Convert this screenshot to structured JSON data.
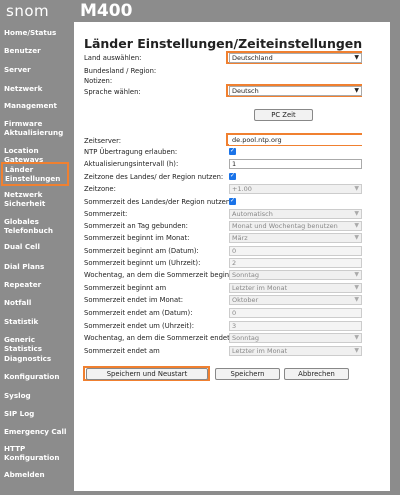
{
  "header": {
    "brand": "snom",
    "model": "M400"
  },
  "sidebar": {
    "items": [
      {
        "label": "Home/Status"
      },
      {
        "label": "Benutzer"
      },
      {
        "label": "Server"
      },
      {
        "label": "Netzwerk"
      },
      {
        "label": "Management"
      },
      {
        "label": "Firmware Aktualisierung"
      },
      {
        "label": "Location Gateways"
      },
      {
        "label": "Länder Einstellungen"
      },
      {
        "label": "Netzwerk Sicherheit"
      },
      {
        "label": "Globales Telefonbuch"
      },
      {
        "label": "Dual Cell"
      },
      {
        "label": "Dial Plans"
      },
      {
        "label": "Repeater"
      },
      {
        "label": "Notfall"
      },
      {
        "label": "Statistik"
      },
      {
        "label": "Generic Statistics"
      },
      {
        "label": "Diagnostics"
      },
      {
        "label": "Konfiguration"
      },
      {
        "label": "Syslog"
      },
      {
        "label": "SIP Log"
      },
      {
        "label": "Emergency Call"
      },
      {
        "label": "HTTP Konfiguration"
      },
      {
        "label": "Abmelden"
      }
    ]
  },
  "main": {
    "title": "Länder Einstellungen/Zeiteinstellungen",
    "country_label": "Land auswählen:",
    "country_value": "Deutschland",
    "region_label": "Bundesland / Region:",
    "notes_label": "Notizen:",
    "language_label": "Sprache wählen:",
    "language_value": "Deutsch",
    "pc_time_button": "PC Zeit",
    "timeserver_label": "Zeitserver:",
    "timeserver_value": "de.pool.ntp.org",
    "ntp_label": "NTP Übertragung erlauben:",
    "ntp_checked": true,
    "interval_label": "Aktualisierungsintervall (h):",
    "interval_value": "1",
    "use_region_tz_label": "Zeitzone des Landes/ der Region nutzen:",
    "use_region_tz_checked": true,
    "timezone_label": "Zeitzone:",
    "timezone_value": "+1.00",
    "use_region_dst_label": "Sommerzeit des Landes/der Region nutzen:",
    "use_region_dst_checked": true,
    "dst_label": "Sommerzeit:",
    "dst_value": "Automatisch",
    "dst_day_label": "Sommerzeit an Tag gebunden:",
    "dst_day_value": "Monat und Wochentag benutzen",
    "dst_start_month_label": "Sommerzeit beginnt im Monat:",
    "dst_start_month_value": "März",
    "dst_start_date_label": "Sommerzeit beginnt am (Datum):",
    "dst_start_date_value": "0",
    "dst_start_time_label": "Sommerzeit beginnt um (Uhrzeit):",
    "dst_start_time_value": "2",
    "dst_start_weekday_label": "Wochentag, an dem die Sommerzeit beginnt:",
    "dst_start_weekday_value": "Sonntag",
    "dst_start_on_label": "Sommerzeit beginnt am",
    "dst_start_on_value": "Letzter im Monat",
    "dst_end_month_label": "Sommerzeit endet im Monat:",
    "dst_end_month_value": "Oktober",
    "dst_end_date_label": "Sommerzeit endet am (Datum):",
    "dst_end_date_value": "0",
    "dst_end_time_label": "Sommerzeit endet um (Uhrzeit):",
    "dst_end_time_value": "3",
    "dst_end_weekday_label": "Wochentag, an dem die Sommerzeit endet:",
    "dst_end_weekday_value": "Sonntag",
    "dst_end_on_label": "Sommerzeit endet am",
    "dst_end_on_value": "Letzter im Monat",
    "save_restart_button": "Speichern und Neustart",
    "save_button": "Speichern",
    "cancel_button": "Abbrechen"
  },
  "colors": {
    "highlight": "#f08030",
    "sidebar_bg": "#8c8c8c",
    "checkbox": "#1a73e8"
  }
}
